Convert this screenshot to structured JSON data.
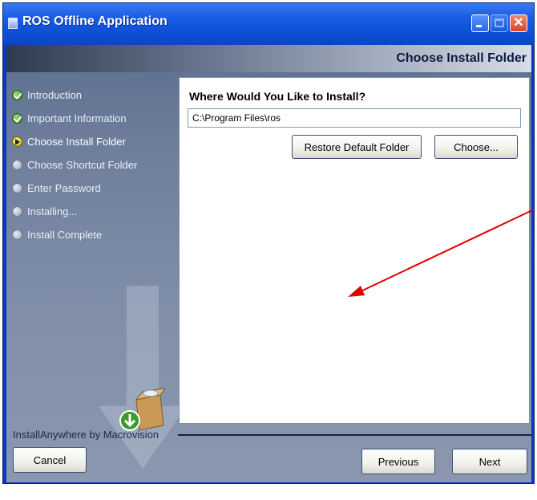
{
  "window": {
    "title": "ROS Offline Application",
    "title_bar_color": "#1d5ee8",
    "close_label": "✕"
  },
  "header": {
    "step_title": "Choose Install Folder"
  },
  "sidebar": {
    "steps": [
      {
        "label": "Introduction",
        "status": "done"
      },
      {
        "label": "Important Information",
        "status": "done"
      },
      {
        "label": "Choose Install Folder",
        "status": "current"
      },
      {
        "label": "Choose Shortcut Folder",
        "status": "pending"
      },
      {
        "label": "Enter Password",
        "status": "pending"
      },
      {
        "label": "Installing...",
        "status": "pending"
      },
      {
        "label": "Install Complete",
        "status": "pending"
      }
    ]
  },
  "main": {
    "question": "Where Would You Like to Install?",
    "install_path": "C:\\Program Files\\ros",
    "restore_button": "Restore Default Folder",
    "choose_button": "Choose..."
  },
  "footer": {
    "brand": "InstallAnywhere by Macrovision",
    "cancel_button": "Cancel",
    "previous_button": "Previous",
    "next_button": "Next"
  },
  "annotation": {
    "arrow_color": "#e00000"
  }
}
